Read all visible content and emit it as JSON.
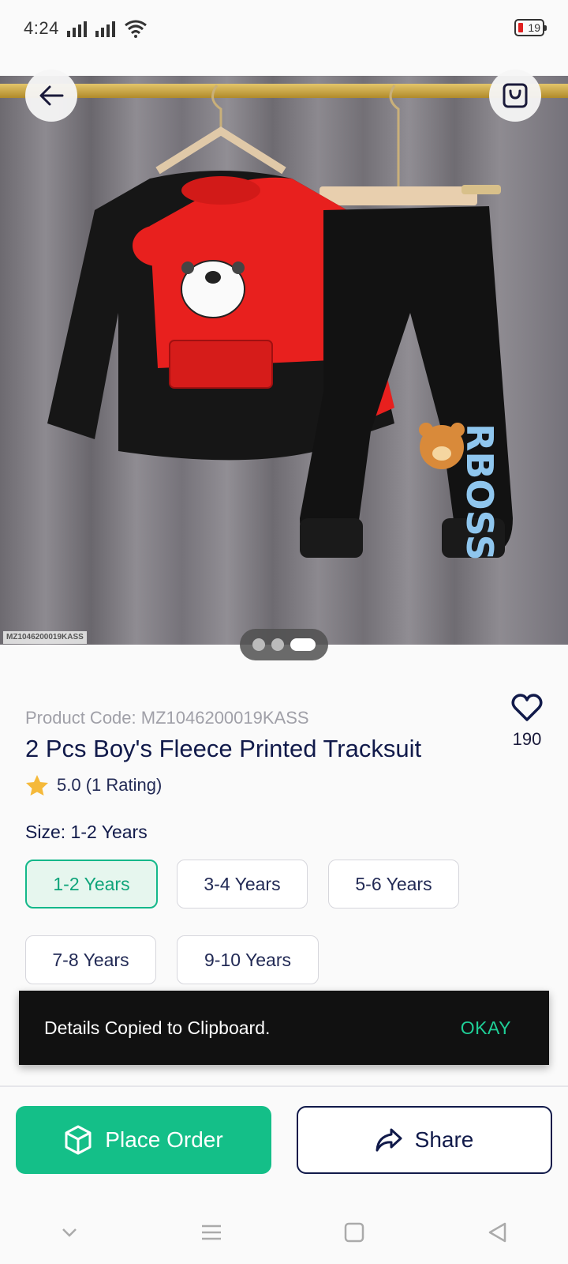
{
  "status_bar": {
    "time": "4:24",
    "battery": "19"
  },
  "gallery": {
    "sku_watermark": "MZ1046200019KASS",
    "image_text": "RBOSS",
    "slides": 3,
    "active_slide": 3
  },
  "product": {
    "code_label": "Product Code: MZ1046200019KASS",
    "title": "2 Pcs Boy's Fleece Printed Tracksuit",
    "rating_text": "5.0 (1 Rating)",
    "wishlist_count": "190"
  },
  "size": {
    "label": "Size:",
    "selected": "1-2 Years",
    "options": [
      "1-2 Years",
      "3-4 Years",
      "5-6 Years",
      "7-8 Years",
      "9-10 Years"
    ]
  },
  "snackbar": {
    "message": "Details Copied to Clipboard.",
    "action": "OKAY"
  },
  "actions": {
    "place_order": "Place Order",
    "share": "Share"
  },
  "colors": {
    "accent": "#14bf88",
    "navy": "#111a4a",
    "star": "#f5b93a"
  }
}
